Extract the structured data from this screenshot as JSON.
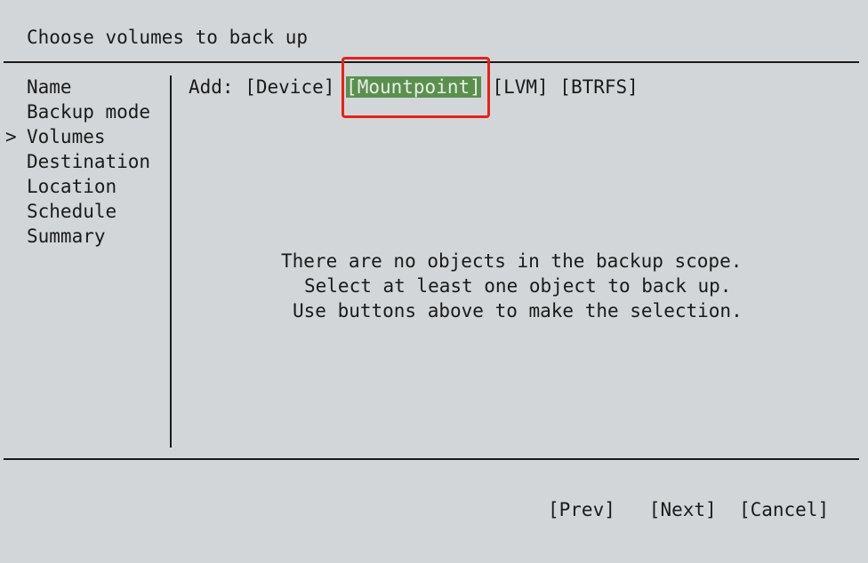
{
  "title": "Choose volumes to back up",
  "nav": {
    "marker": ">",
    "items": [
      "Name",
      "Backup mode",
      "Volumes",
      "Destination",
      "Location",
      "Schedule",
      "Summary"
    ],
    "active": "Volumes"
  },
  "add_bar": {
    "label": "Add:",
    "buttons": [
      "[Device]",
      "[Mountpoint]",
      "[LVM]",
      "[BTRFS]"
    ],
    "selected": "[Mountpoint]"
  },
  "empty_message": [
    "There are no objects in the backup scope.",
    "Select at least one object to back up.",
    "Use buttons above to make the selection."
  ],
  "footer": {
    "prev": "[Prev]",
    "next": "[Next]",
    "cancel": "[Cancel]"
  },
  "colors": {
    "background": "#d2d6d9",
    "selected_button": "#5a8f4e",
    "highlight_box": "#e3231a"
  }
}
